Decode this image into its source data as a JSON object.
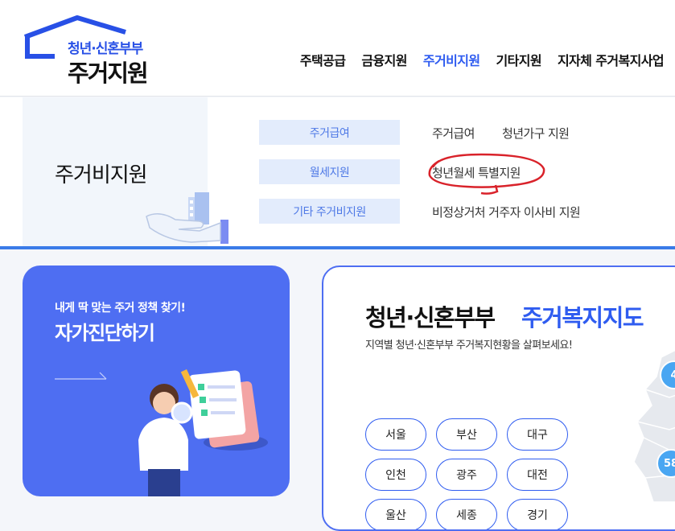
{
  "logo": {
    "sub": "청년·신혼부부",
    "main": "주거지원"
  },
  "gnb": [
    {
      "label": "주택공급",
      "active": false
    },
    {
      "label": "금융지원",
      "active": false
    },
    {
      "label": "주거비지원",
      "active": true
    },
    {
      "label": "기타지원",
      "active": false
    },
    {
      "label": "지자체 주거복지사업",
      "active": false
    }
  ],
  "submenu": {
    "title": "주거비지원",
    "categories": [
      {
        "label": "주거급여",
        "links": [
          "주거급여",
          "청년가구 지원"
        ]
      },
      {
        "label": "월세지원",
        "links": [
          "청년월세 특별지원"
        ]
      },
      {
        "label": "기타 주거비지원",
        "links": [
          "비정상거처 거주자 이사비 지원"
        ]
      }
    ]
  },
  "self_check": {
    "small": "내게 딱 맞는 주거 정책 찾기!",
    "big": "자가진단하기"
  },
  "welfare_map": {
    "title_a": "청년·신혼부부",
    "title_b": "주거복지지도",
    "desc": "지역별 청년·신혼부부 주거복지현황을 살펴보세요!",
    "regions": [
      "서울",
      "부산",
      "대구",
      "인천",
      "광주",
      "대전",
      "울산",
      "세종",
      "경기"
    ],
    "badges": [
      "4",
      "58"
    ]
  },
  "colors": {
    "accent": "#2f5cf0",
    "card_blue": "#4e6ef2",
    "highlight": "#d9222a"
  }
}
